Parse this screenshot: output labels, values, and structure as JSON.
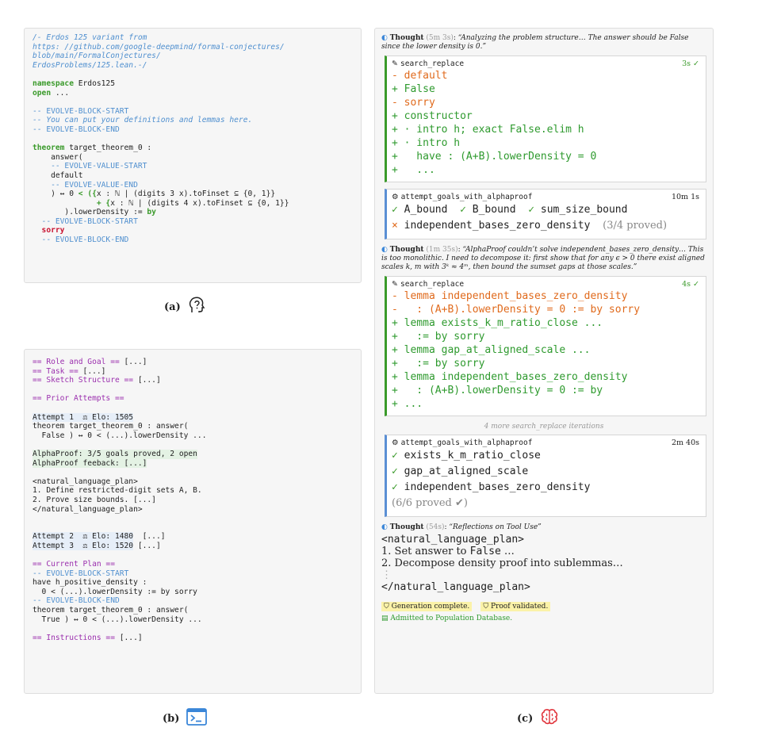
{
  "panel_a": {
    "header": [
      "/- Erdos 125 variant from",
      "https: //github.com/google-deepmind/formal-conjectures/",
      "blob/main/FormalConjectures/",
      "ErdosProblems/125.lean.-/"
    ],
    "ns_kw": "namespace",
    "ns_name": " Erdos125",
    "open_kw": "open",
    "open_rest": " ...",
    "block_start": "-- EVOLVE-BLOCK-START",
    "block_comment": "-- You can put your definitions and lemmas here.",
    "block_end": "-- EVOLVE-BLOCK-END",
    "thm_kw": "theorem",
    "thm_rest": " target_theorem_0 :",
    "answer": "    answer(",
    "vstart": "    -- EVOLVE-VALUE-START",
    "default": "    default",
    "vend": "    -- EVOLVE-VALUE-END",
    "l1a": "    ) ↔ 0 ",
    "l1b": "< ({",
    "l1c": "x : ℕ | (digits 3 x).toFinset ⊆ {0, 1}}",
    "l2a": "              + {",
    "l2b": "x : ℕ | (digits 4 x).toFinset ⊆ {0, 1}}",
    "l3a": "       ).lowerDensity := ",
    "l3b": "by",
    "bs2": "  -- EVOLVE-BLOCK-START",
    "sorry": "  sorry",
    "be2": "  -- EVOLVE-BLOCK-END"
  },
  "caption_a": "(a)",
  "panel_b": {
    "role": "== Role and Goal ==",
    "role_rest": " [...]",
    "task": "== Task ==",
    "task_rest": " [...]",
    "sketch": "== Sketch Structure ==",
    "sketch_rest": " [...]",
    "prior": "== Prior Attempts ==",
    "att1": "Attempt 1  ⚖ Elo: 1505",
    "att1_l1": "theorem target_theorem_0 : answer(",
    "att1_l2": "  False ) ↔ 0 < (...).lowerDensity ...",
    "ap1": "AlphaProof: 3/5 goals proved, 2 open",
    "ap2": "AlphaProof feeback: [...]",
    "nlp_open": "<natural_language_plan>",
    "nlp_1": "1. Define restricted-digit sets A, B.",
    "nlp_2": "2. Prove size bounds. [...]",
    "nlp_close": "</natural_language_plan>",
    "att2": "Attempt 2  ⚖ Elo: 1480",
    "att2_rest": "  [...]",
    "att3": "Attempt 3  ⚖ Elo: 1520",
    "att3_rest": " [...]",
    "cur_plan": "== Current Plan ==",
    "bs": "-- EVOLVE-BLOCK-START",
    "have1": "have h_positive_density :",
    "have2": "  0 < (...).lowerDensity := by sorry",
    "be": "-- EVOLVE-BLOCK-END",
    "thm1": "theorem target_theorem_0 : answer(",
    "thm2": "  True ) ↔ 0 < (...).lowerDensity ...",
    "instr": "== Instructions ==",
    "instr_rest": " [...]"
  },
  "caption_b": "(b)",
  "panel_c": {
    "t1_label": "Thought",
    "t1_time": " (5m 3s)",
    "t1_colon": ": ",
    "t1_text": "“Analyzing the problem structure… The answer should be False since the lower density is 0.”",
    "sr1_name": "search_replace",
    "sr1_time": "3s ✓",
    "sr1_lines": [
      {
        "kind": "del",
        "text": "- default"
      },
      {
        "kind": "add",
        "text": "+ False"
      },
      {
        "kind": "del",
        "text": "- sorry"
      },
      {
        "kind": "add",
        "text": "+ constructor"
      },
      {
        "kind": "add",
        "text": "+ · intro h; exact False.elim h"
      },
      {
        "kind": "add",
        "text": "+ · intro h"
      },
      {
        "kind": "add",
        "text": "+   have : (A+B).lowerDensity = 0"
      },
      {
        "kind": "add",
        "text": "+   ..."
      }
    ],
    "ap1_name": "attempt_goals_with_alphaproof",
    "ap1_time": "10m 1s",
    "ap1_g1": "A_bound",
    "ap1_g2": "B_bound",
    "ap1_g3": "sum_size_bound",
    "ap1_g4": "independent_bases_zero_density",
    "ap1_g4_note": "(3/4 proved)",
    "t2_label": "Thought",
    "t2_time": " (1m 35s)",
    "t2_colon": ": ",
    "t2_text": "“AlphaProof couldn’t solve independent_bases_zero_density… This is too monolithic. I need to decompose it: first show that for any ϵ > 0 there exist aligned scales k, m with 3ᵏ ≈ 4ᵐ, then bound the sumset gaps at those scales.”",
    "sr2_name": "search_replace",
    "sr2_time": "4s ✓",
    "sr2_lines": [
      {
        "kind": "del",
        "text": "- lemma independent_bases_zero_density"
      },
      {
        "kind": "del",
        "text": "-   : (A+B).lowerDensity = 0 := by sorry"
      },
      {
        "kind": "add",
        "text": "+ lemma exists_k_m_ratio_close ..."
      },
      {
        "kind": "add",
        "text": "+   := by sorry"
      },
      {
        "kind": "add",
        "text": "+ lemma gap_at_aligned_scale ..."
      },
      {
        "kind": "add",
        "text": "+   := by sorry"
      },
      {
        "kind": "add",
        "text": "+ lemma independent_bases_zero_density"
      },
      {
        "kind": "add",
        "text": "+   : (A+B).lowerDensity = 0 := by"
      },
      {
        "kind": "add",
        "text": "+ ..."
      }
    ],
    "more": "4 more search_replace iterations",
    "ap2_name": "attempt_goals_with_alphaproof",
    "ap2_time": "2m 40s",
    "ap2_g1": "exists_k_m_ratio_close",
    "ap2_g2": "gap_at_aligned_scale",
    "ap2_g3": "independent_bases_zero_density",
    "ap2_note": "(6/6 proved ✔)",
    "t3_label": "Thought",
    "t3_time": " (54s)",
    "t3_colon": ": ",
    "t3_text": "“Reflections on Tool Use”",
    "plan_open": "<natural_language_plan>",
    "plan_1a": "1. Set answer to ",
    "plan_1b": "False",
    "plan_1c": " …",
    "plan_2": "2. Decompose density proof into sublemmas…",
    "plan_close": "</natural_language_plan>",
    "badge1": "Generation complete.",
    "badge2": "Proof validated.",
    "admitted": "Admitted to Population Database."
  },
  "caption_c": "(c)"
}
